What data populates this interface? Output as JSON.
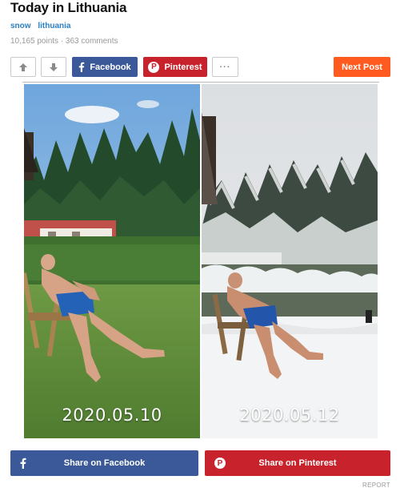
{
  "post": {
    "title": "Today in Lithuania",
    "tags": [
      "snow",
      "lithuania"
    ],
    "stats": "10,165 points · 363 comments"
  },
  "toolbar": {
    "upvote_icon": "arrow-up-icon",
    "downvote_icon": "arrow-down-icon",
    "facebook_label": "Facebook",
    "pinterest_label": "Pinterest",
    "more_label": "···",
    "next_label": "Next Post"
  },
  "photos": {
    "left_date": "2020.05.10",
    "right_date": "2020.05.12"
  },
  "share": {
    "facebook_label": "Share on Facebook",
    "pinterest_label": "Share on Pinterest"
  },
  "report_label": "REPORT",
  "colors": {
    "facebook": "#3b5998",
    "pinterest": "#c8232c",
    "next": "#ff5a1f",
    "tag": "#2b7fc2"
  }
}
